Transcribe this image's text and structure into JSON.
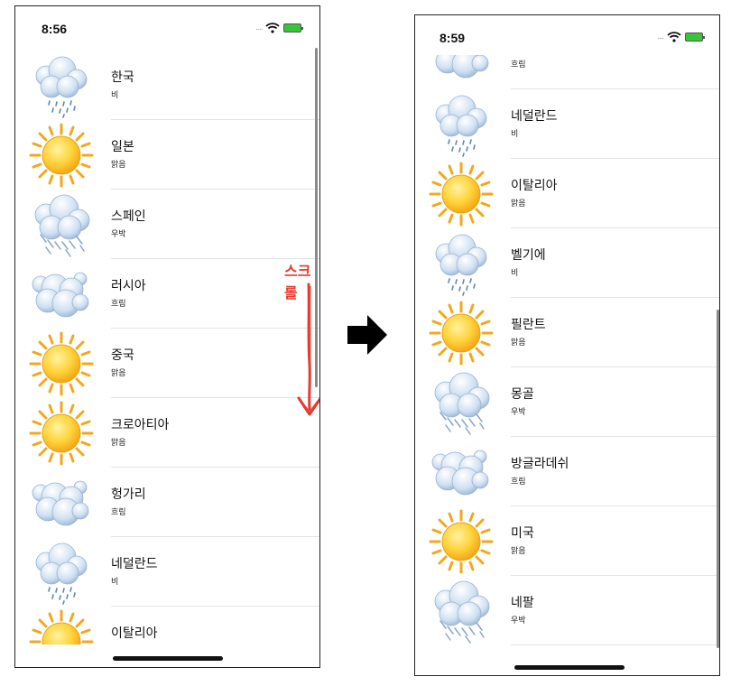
{
  "left": {
    "time": "8:56",
    "status_dots": "....",
    "items": [
      {
        "name": "한국",
        "condition": "비",
        "icon": "rain-cloud-icon"
      },
      {
        "name": "일본",
        "condition": "맑음",
        "icon": "sun-icon"
      },
      {
        "name": "스페인",
        "condition": "우박",
        "icon": "hail-cloud-icon"
      },
      {
        "name": "러시아",
        "condition": "흐림",
        "icon": "cloud-icon"
      },
      {
        "name": "중국",
        "condition": "맑음",
        "icon": "sun-icon"
      },
      {
        "name": "크로아티아",
        "condition": "맑음",
        "icon": "sun-icon"
      },
      {
        "name": "헝가리",
        "condition": "흐림",
        "icon": "cloud-icon"
      },
      {
        "name": "네덜란드",
        "condition": "비",
        "icon": "rain-cloud-icon"
      },
      {
        "name": "이탈리아",
        "condition": "",
        "icon": "sun-icon"
      }
    ]
  },
  "annotation": {
    "scroll_label": "스크롤",
    "color": "#e53b30"
  },
  "right": {
    "time": "8:59",
    "status_dots": "....",
    "items": [
      {
        "name": "",
        "condition": "흐림",
        "icon": "cloud-icon"
      },
      {
        "name": "네덜란드",
        "condition": "비",
        "icon": "rain-cloud-icon"
      },
      {
        "name": "이탈리아",
        "condition": "맑음",
        "icon": "sun-icon"
      },
      {
        "name": "벨기에",
        "condition": "비",
        "icon": "rain-cloud-icon"
      },
      {
        "name": "필란트",
        "condition": "맑음",
        "icon": "sun-icon"
      },
      {
        "name": "몽골",
        "condition": "우박",
        "icon": "hail-cloud-icon"
      },
      {
        "name": "방글라데쉬",
        "condition": "흐림",
        "icon": "cloud-icon"
      },
      {
        "name": "미국",
        "condition": "맑음",
        "icon": "sun-icon"
      },
      {
        "name": "네팔",
        "condition": "우박",
        "icon": "hail-cloud-icon"
      }
    ]
  }
}
